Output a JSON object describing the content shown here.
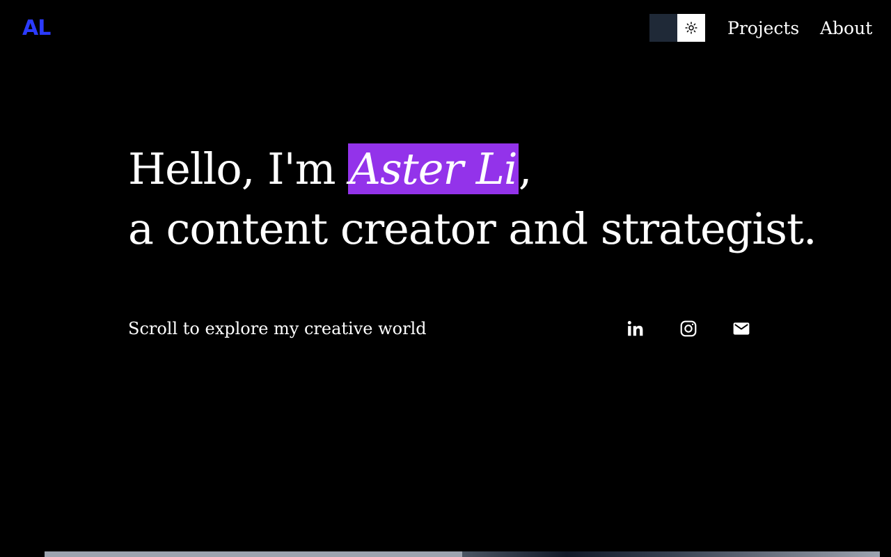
{
  "header": {
    "logo": "AL",
    "theme_toggle": {
      "icon": "sun-icon",
      "state": "light-knob"
    },
    "nav": [
      {
        "label": "Projects"
      },
      {
        "label": "About"
      }
    ]
  },
  "hero": {
    "greeting_prefix": "Hello, I'm ",
    "name": "Aster Li",
    "greeting_suffix": ",",
    "tagline": "a content creator and strategist.",
    "scroll_prompt": "Scroll to explore my creative world"
  },
  "social": [
    {
      "icon": "linkedin-icon"
    },
    {
      "icon": "instagram-icon"
    },
    {
      "icon": "email-icon"
    }
  ],
  "colors": {
    "background": "#000000",
    "text": "#ffffff",
    "logo": "#2b3bff",
    "name_highlight": "#9333ea",
    "toggle_track": "#1f2937",
    "toggle_knob": "#ffffff"
  }
}
